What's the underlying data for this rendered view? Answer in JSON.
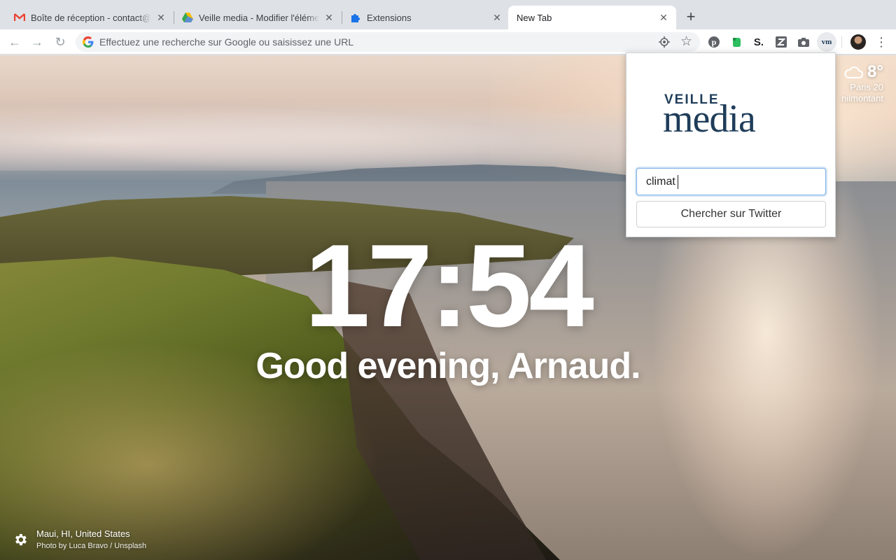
{
  "tabs": [
    {
      "title": "Boîte de réception - contact@a",
      "favicon": "gmail-icon"
    },
    {
      "title": "Veille media - Modifier l'élémen",
      "favicon": "drive-icon"
    },
    {
      "title": "Extensions",
      "favicon": "puzzle-icon"
    },
    {
      "title": "New Tab",
      "favicon": null,
      "active": true
    }
  ],
  "toolbar": {
    "omnibox_placeholder": "Effectuez une recherche sur Google ou saisissez une URL",
    "extensions": [
      "pinterest-icon",
      "evernote-icon",
      "s-icon",
      "z-icon",
      "camera-icon",
      "vm-icon"
    ]
  },
  "newtab": {
    "time": "17:54",
    "greeting": "Good evening, Arnaud.",
    "weather": {
      "temp": "8°",
      "city": "Paris 20",
      "district": "nilmontant"
    },
    "photo_location": "Maui, HI, United States",
    "photo_credit": "Photo by Luca Bravo / Unsplash"
  },
  "popup": {
    "logo_top": "VEILLE",
    "logo_bottom": "media",
    "search_value": "climat",
    "button_label": "Chercher sur Twitter"
  },
  "colors": {
    "logo": "#1f3d5a",
    "focus": "#7fb3e6",
    "tab_strip": "#dee1e6"
  }
}
